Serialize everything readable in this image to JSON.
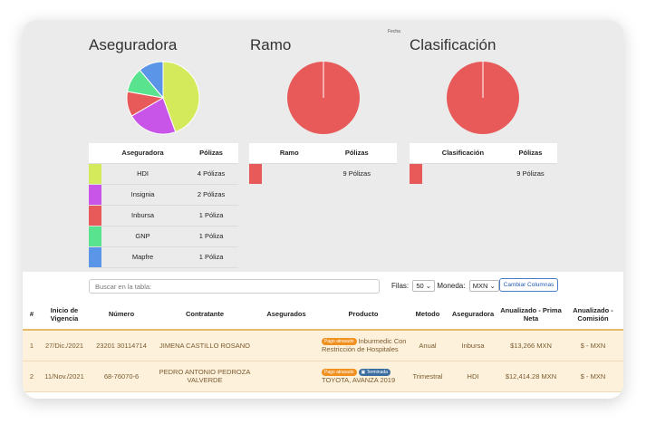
{
  "header": {
    "fecha_label": "Fecha"
  },
  "sections": {
    "aseguradora": "Aseguradora",
    "ramo": "Ramo",
    "clasificacion": "Clasificación"
  },
  "colors": {
    "hdi": "#d4ea5a",
    "insignia": "#c955e8",
    "inbursa": "#e85a5a",
    "gnp": "#5ae38f",
    "mapfre": "#5b95e8"
  },
  "aseguradora_table": {
    "col1": "Aseguradora",
    "col2": "Pólizas",
    "rows": [
      {
        "name": "HDI",
        "count": "4 Pólizas",
        "color": "#d4ea5a"
      },
      {
        "name": "Insignia",
        "count": "2 Pólizas",
        "color": "#c955e8"
      },
      {
        "name": "Inbursa",
        "count": "1 Póliza",
        "color": "#e85a5a"
      },
      {
        "name": "GNP",
        "count": "1 Póliza",
        "color": "#5ae38f"
      },
      {
        "name": "Mapfre",
        "count": "1 Póliza",
        "color": "#5b95e8"
      }
    ]
  },
  "ramo_table": {
    "col1": "Ramo",
    "col2": "Pólizas",
    "row_count": "9 Pólizas"
  },
  "clasificacion_table": {
    "col1": "Clasificación",
    "col2": "Pólizas",
    "row_count": "9 Pólizas"
  },
  "chart_data": [
    {
      "type": "pie",
      "title": "Aseguradora",
      "categories": [
        "HDI",
        "Insignia",
        "Inbursa",
        "GNP",
        "Mapfre"
      ],
      "values": [
        4,
        2,
        1,
        1,
        1
      ],
      "colors": [
        "#d4ea5a",
        "#c955e8",
        "#e85a5a",
        "#5ae38f",
        "#5b95e8"
      ]
    },
    {
      "type": "pie",
      "title": "Ramo",
      "categories": [
        ""
      ],
      "values": [
        9
      ],
      "colors": [
        "#e85a5a"
      ]
    },
    {
      "type": "pie",
      "title": "Clasificación",
      "categories": [
        ""
      ],
      "values": [
        9
      ],
      "colors": [
        "#e85a5a"
      ]
    }
  ],
  "controls": {
    "search_placeholder": "Buscar en la tabla:",
    "files_label": "Filas:",
    "files_value": "50",
    "moneda_label": "Moneda:",
    "moneda_value": "MXN",
    "cambiar_columnas": "Cambiar Columnas"
  },
  "table": {
    "headers": [
      "#",
      "Inicio de Vigencia",
      "Número",
      "Contratante",
      "Asegurados",
      "Producto",
      "Metodo",
      "Aseguradora",
      "Anualizado - Prima Neta",
      "Anualizado - Comisión"
    ],
    "rows": [
      {
        "num": "1",
        "inicio": "27/Dic./2021",
        "numero": "23201 30114714",
        "contratante": "JIMENA CASTILLO ROSANO",
        "asegurados": "",
        "badge1": "Pago atrasado",
        "badge2": "",
        "producto": "Inburmedic Con Restricción de Hospitales",
        "metodo": "Anual",
        "aseguradora": "Inbursa",
        "prima": "$13,266 MXN",
        "comision": "$ - MXN"
      },
      {
        "num": "2",
        "inicio": "11/Nov./2021",
        "numero": "68-76070-6",
        "contratante": "PEDRO ANTONIO PEDROZA VALVERDE",
        "asegurados": "",
        "badge1": "Pago atrasado",
        "badge2": "Terminada",
        "producto": "TOYOTA, AVANZA 2019",
        "metodo": "Trimestral",
        "aseguradora": "HDI",
        "prima": "$12,414.28 MXN",
        "comision": "$ - MXN"
      }
    ]
  }
}
